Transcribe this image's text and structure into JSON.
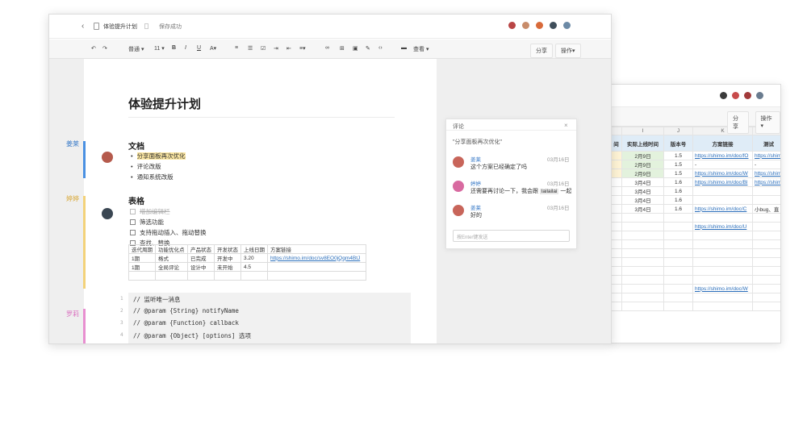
{
  "doc": {
    "title": "体验提升计划",
    "save_status": "保存成功",
    "toolbar": {
      "style": "普通",
      "size": "11",
      "view": "查看",
      "share": "分享",
      "ops": "操作"
    },
    "heading": "体验提升计划",
    "sections": {
      "doc_heading": "文档",
      "doc_items": [
        "分享面板再次优化",
        "评论改版",
        "通知系统改版"
      ],
      "table_heading": "表格",
      "tasks": [
        {
          "label": "增加编辑栏",
          "done": true
        },
        {
          "label": "筛选功能",
          "done": false
        },
        {
          "label": "支持拖动插入、拖动替换",
          "done": false
        },
        {
          "label": "查找、替换",
          "done": false
        }
      ]
    },
    "side_names": [
      "姜莱",
      "婷婷",
      "罗莉"
    ],
    "comment_count": "3",
    "table": {
      "headers": [
        "迭代周期",
        "功能优化点",
        "产品状态",
        "开发状态",
        "上线日期",
        "方案链接"
      ],
      "rows": [
        [
          "1期",
          "格式",
          "已完成",
          "开发中",
          "3.20",
          "https://shimo.im/doc/sv8EO0jQqm4BtJ"
        ],
        [
          "1期",
          "全局评论",
          "设计中",
          "未开始",
          "4.5",
          ""
        ],
        [
          "",
          "",
          "",
          "",
          "",
          ""
        ]
      ]
    },
    "code": {
      "line_numbers": [
        "1",
        "2",
        "3",
        "4"
      ],
      "lines": [
        "//  监听唯一消息",
        "// @param {String} notifyName",
        "// @param {Function} callback",
        "// @param {Object} [options] 选项"
      ]
    }
  },
  "comments": {
    "title": "评论",
    "close": "×",
    "quote": "\"分享面板再次优化\"",
    "items": [
      {
        "name": "姜莱",
        "date": "03月16日",
        "text": "这个方案已经确定了吗",
        "tag": ""
      },
      {
        "name": "婷婷",
        "date": "03月16日",
        "text": "还需要再讨论一下，我会跟",
        "tag": "lailailai",
        "tail": "一起"
      },
      {
        "name": "姜莱",
        "date": "03月16日",
        "text": "好的",
        "tag": ""
      }
    ],
    "input_placeholder": "按Enter键发送"
  },
  "sheet": {
    "share": "分享",
    "ops": "操作",
    "col_letters": [
      "",
      "I",
      "J",
      "K",
      "L"
    ],
    "headers": [
      "间",
      "实际上线时间",
      "版本号",
      "方案链接",
      "测试"
    ],
    "rows": [
      [
        "",
        "2月9日",
        "1.5",
        "https://shimo.im/doc/fO",
        "https://shim"
      ],
      [
        "",
        "2月9日",
        "1.5",
        "-",
        "-"
      ],
      [
        "",
        "2月9日",
        "1.5",
        "https://shimo.im/doc/W",
        "https://shim"
      ],
      [
        "",
        "3月4日",
        "1.6",
        "https://shimo.im/doc/Bl",
        "https://shim"
      ],
      [
        "",
        "3月4日",
        "1.6",
        "",
        ""
      ],
      [
        "",
        "3月4日",
        "1.6",
        "",
        ""
      ],
      [
        "",
        "3月4日",
        "1.6",
        "https://shimo.im/doc/C",
        "小bug、直"
      ],
      [
        "",
        "",
        "",
        "",
        ""
      ],
      [
        "",
        "",
        "",
        "https://shimo.im/doc/U",
        ""
      ],
      [
        "",
        "",
        "",
        "",
        ""
      ],
      [
        "",
        "",
        "",
        "",
        ""
      ],
      [
        "",
        "",
        "",
        "",
        ""
      ],
      [
        "",
        "",
        "",
        "",
        ""
      ],
      [
        "",
        "",
        "",
        "",
        ""
      ],
      [
        "",
        "",
        "",
        "",
        ""
      ],
      [
        "",
        "",
        "",
        "https://shimo.im/doc/W",
        ""
      ],
      [
        "",
        "",
        "",
        "",
        ""
      ],
      [
        "",
        "",
        "",
        "",
        ""
      ]
    ]
  },
  "colors": {
    "blue_marker": "#4a90e2",
    "yellow_marker": "#f3d27a",
    "pink_marker": "#e88fd0",
    "name_blue": "#3a7bc8",
    "name_yellow": "#d9a93a",
    "name_pink": "#d96fbf"
  }
}
